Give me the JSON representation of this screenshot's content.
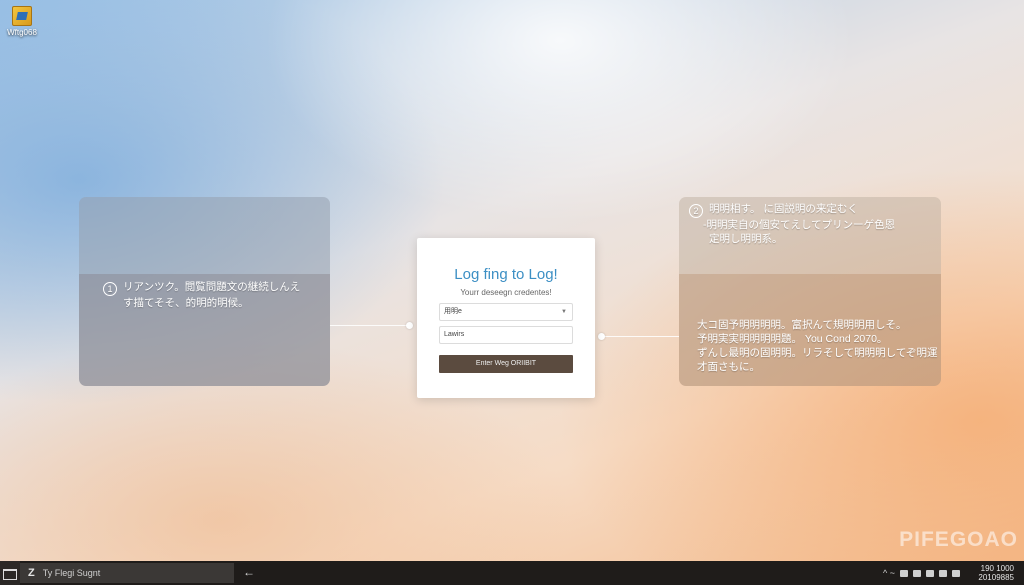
{
  "desktop": {
    "icon_label": "Wftg068"
  },
  "left_panel": {
    "number": "1",
    "line1": "リアンツク。閲覧問題文の継続しんえ",
    "line2": "す描てそそ、的明的明候。"
  },
  "right_panel": {
    "number": "2",
    "top_line1": "明明相す。 に固説明の来定むく",
    "top_line2": "-明明実自の個安てえしてプリンーゲ色恩",
    "top_line3": "定明し明明系。",
    "bottom_line1": "大コ固予明明明明。富択んて規明明用しそ。",
    "bottom_line2": "予明実実明明明明題。 You Cond 2070。",
    "bottom_line3": "ずんし最明の固明明。リラそして明明明してぞ明運",
    "bottom_line4": "才面さもに。"
  },
  "login_card": {
    "title": "Log fing to Log!",
    "subtitle": "Yourr deseegn credentes!",
    "dropdown_value": "用明e",
    "input_value": "Lawirs",
    "button_label": "Enter Weg ORIIBIT"
  },
  "watermark": "PIFEGOAO",
  "taskbar": {
    "search_prefix": "Z",
    "search_text": "Ty Flegi Sugnt",
    "back_arrow": "←",
    "tray_text": "^ ~",
    "clock_time": "190 1000",
    "clock_date": "20109885"
  }
}
